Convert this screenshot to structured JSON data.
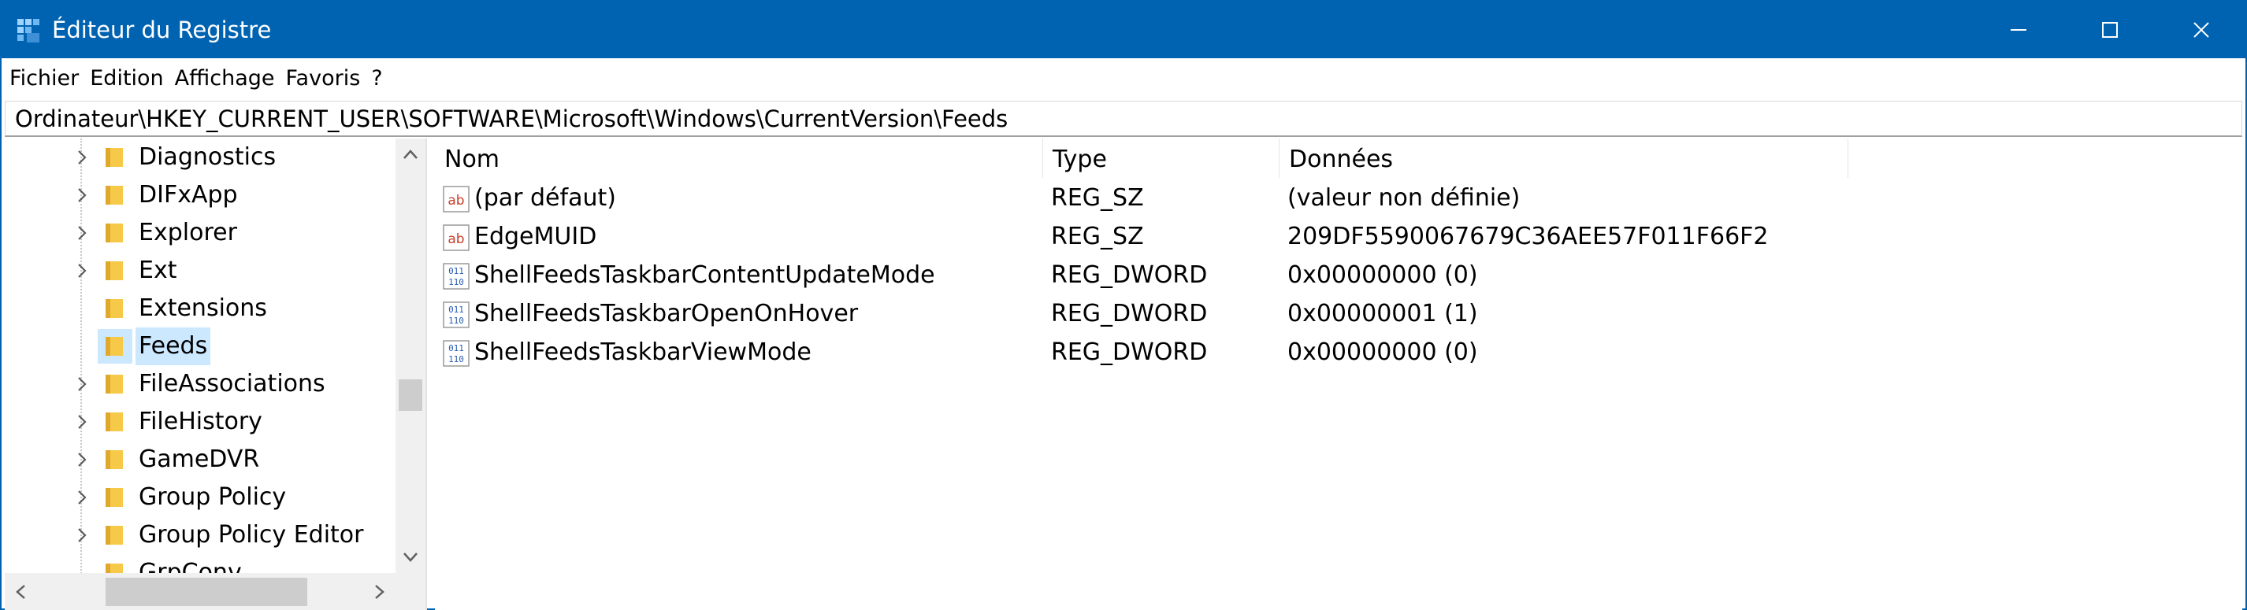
{
  "window": {
    "title": "Éditeur du Registre",
    "accent_color": "#0063b1",
    "controls": {
      "minimize_icon": "minimize-icon",
      "maximize_icon": "maximize-icon",
      "close_icon": "close-icon"
    }
  },
  "menu": {
    "items": [
      "Fichier",
      "Edition",
      "Affichage",
      "Favoris",
      "?"
    ]
  },
  "address": {
    "path": "Ordinateur\\HKEY_CURRENT_USER\\SOFTWARE\\Microsoft\\Windows\\CurrentVersion\\Feeds"
  },
  "tree": {
    "selected_color": "#cce8ff",
    "folder_color": "#f7c948",
    "items": [
      {
        "label": "Diagnostics",
        "has_children": true,
        "selected": false
      },
      {
        "label": "DIFxApp",
        "has_children": true,
        "selected": false
      },
      {
        "label": "Explorer",
        "has_children": true,
        "selected": false
      },
      {
        "label": "Ext",
        "has_children": true,
        "selected": false
      },
      {
        "label": "Extensions",
        "has_children": false,
        "selected": false
      },
      {
        "label": "Feeds",
        "has_children": false,
        "selected": true
      },
      {
        "label": "FileAssociations",
        "has_children": true,
        "selected": false
      },
      {
        "label": "FileHistory",
        "has_children": true,
        "selected": false
      },
      {
        "label": "GameDVR",
        "has_children": true,
        "selected": false
      },
      {
        "label": "Group Policy",
        "has_children": true,
        "selected": false
      },
      {
        "label": "Group Policy Editor",
        "has_children": true,
        "selected": false
      },
      {
        "label": "GrpConv",
        "has_children": false,
        "selected": false
      }
    ]
  },
  "values": {
    "columns": {
      "name": "Nom",
      "type": "Type",
      "data": "Données"
    },
    "rows": [
      {
        "icon": "string-value-icon",
        "name": "(par défaut)",
        "type": "REG_SZ",
        "data": "(valeur non définie)"
      },
      {
        "icon": "string-value-icon",
        "name": "EdgeMUID",
        "type": "REG_SZ",
        "data": "209DF5590067679C36AEE57F011F66F2"
      },
      {
        "icon": "binary-value-icon",
        "name": "ShellFeedsTaskbarContentUpdateMode",
        "type": "REG_DWORD",
        "data": "0x00000000 (0)"
      },
      {
        "icon": "binary-value-icon",
        "name": "ShellFeedsTaskbarOpenOnHover",
        "type": "REG_DWORD",
        "data": "0x00000001 (1)"
      },
      {
        "icon": "binary-value-icon",
        "name": "ShellFeedsTaskbarViewMode",
        "type": "REG_DWORD",
        "data": "0x00000000 (0)"
      }
    ]
  }
}
